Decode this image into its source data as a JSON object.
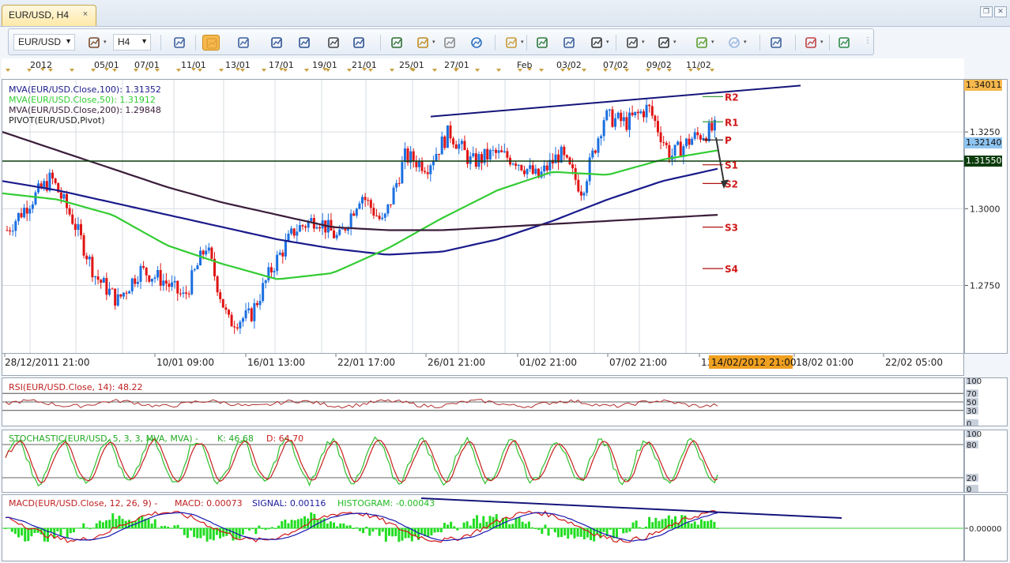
{
  "window": {
    "tab_title": "EUR/USD, H4",
    "close_glyph": "×",
    "restore_glyph": "❐",
    "close_window_glyph": "✕"
  },
  "toolbar": {
    "symbol": "EUR/USD",
    "timeframe": "H4",
    "icons": [
      "symbol-tools-icon",
      "chart-type-icon",
      "candles-icon",
      "ohlc-icon",
      "zoom-in-icon",
      "zoom-out-icon",
      "crosshair-icon",
      "zoom-area-icon",
      "indicator-icon",
      "edit-icon",
      "refresh-icon",
      "globe-icon",
      "ruler-icon",
      "image-icon",
      "template-icon",
      "trend-tools-icon",
      "lines-icon",
      "fib-fan-icon",
      "line-icon",
      "ellipse-icon",
      "text-icon",
      "eraser-icon",
      "hierarchy-icon"
    ],
    "colors": {
      "accent": "#f7b84d",
      "bg": "#e6edf6"
    }
  },
  "top_axis_labels": [
    "2012",
    "05/01",
    "07/01",
    "11/01",
    "13/01",
    "17/01",
    "19/01",
    "21/01",
    "25/01",
    "27/01",
    "Feb",
    "03/02",
    "07/02",
    "09/02",
    "11/02"
  ],
  "price_chart": {
    "legend": [
      {
        "text": "MVA(EUR/USD.Close,100): 1.31352",
        "color": "#1a1a8c"
      },
      {
        "text": "MVA(EUR/USD.Close,50): 1.31912",
        "color": "#33cc33"
      },
      {
        "text": "MVA(EUR/USD.Close,200): 1.29848",
        "color": "#3a1d3a"
      },
      {
        "text": "PIVOT(EUR/USD,Pivot)",
        "color": "#222222"
      }
    ],
    "pivot_labels": [
      "R2",
      "R1",
      "P",
      "S1",
      "S2",
      "S3",
      "S4"
    ],
    "y_ticks": [
      "1.3250",
      "1.3000",
      "1.2750"
    ],
    "price_tags": [
      {
        "text": "1.34011",
        "bg": "#f7b84d"
      },
      {
        "text": "1.32140",
        "bg": "#8fc4f0"
      },
      {
        "text": "1.31550",
        "bg": "#0b3b0b"
      }
    ],
    "bottom_axis_labels": [
      "28/12/2011 21:00",
      "10/01 09:00",
      "16/01 13:00",
      "22/01 17:00",
      "26/01 21:00",
      "01/02 21:00",
      "07/02 21:00",
      "13",
      "14/02/2012 21:00",
      "18/02 01:00",
      "22/02 05:00"
    ]
  },
  "rsi": {
    "label": "RSI(EUR/USD.Close, 14): 48.22",
    "axis": [
      "100",
      "70",
      "50",
      "30",
      "0"
    ]
  },
  "stochastic": {
    "label_prefix": "STOCHASTIC(EUR/USD, 5, 3, 3, MVA, MVA) -",
    "k_label": "K: 46.68",
    "d_label": "D: 64.70",
    "axis": [
      "100",
      "80",
      "20",
      "0"
    ]
  },
  "macd": {
    "label_prefix": "MACD(EUR/USD.Close, 12, 26, 9) -",
    "macd_label": "MACD: 0.00073",
    "signal_label": "SIGNAL: 0.00116",
    "histogram_label": "HISTOGRAM: -0.00043",
    "axis": [
      "0.00000"
    ]
  },
  "chart_data": {
    "type": "candlestick",
    "symbol": "EUR/USD",
    "timeframe": "H4",
    "x_start": "28/12/2011 21:00",
    "x_end_visible": "14/02/2012 21:00",
    "ylim": [
      1.253,
      1.342
    ],
    "y_ticks": [
      1.275,
      1.3,
      1.325
    ],
    "series": [
      {
        "name": "MVA(EUR/USD.Close,100)",
        "last": 1.31352,
        "color": "#1a1a8c",
        "values": [
          1.309,
          1.306,
          1.302,
          1.298,
          1.294,
          1.29,
          1.287,
          1.285,
          1.286,
          1.29,
          1.296,
          1.303,
          1.309,
          1.313
        ]
      },
      {
        "name": "MVA(EUR/USD.Close,50)",
        "last": 1.31912,
        "color": "#33cc33",
        "values": [
          1.305,
          1.303,
          1.298,
          1.288,
          1.282,
          1.277,
          1.279,
          1.287,
          1.297,
          1.306,
          1.312,
          1.311,
          1.316,
          1.319
        ]
      },
      {
        "name": "MVA(EUR/USD.Close,200)",
        "last": 1.29848,
        "color": "#3a1d3a",
        "values": [
          1.325,
          1.319,
          1.313,
          1.307,
          1.302,
          1.298,
          1.294,
          1.293,
          1.293,
          1.294,
          1.295,
          1.296,
          1.297,
          1.298
        ]
      }
    ],
    "close_approx": [
      1.293,
      1.302,
      1.31,
      1.296,
      1.278,
      1.27,
      1.28,
      1.277,
      1.271,
      1.288,
      1.263,
      1.265,
      1.281,
      1.293,
      1.297,
      1.29,
      1.305,
      1.295,
      1.317,
      1.314,
      1.325,
      1.315,
      1.318,
      1.316,
      1.31,
      1.318,
      1.306,
      1.33,
      1.328,
      1.333,
      1.317,
      1.323,
      1.326
    ],
    "pivot_levels": {
      "R2": 1.3365,
      "R1": 1.3283,
      "P": 1.3224,
      "S1": 1.3143,
      "S2": 1.3082,
      "S3": 1.294,
      "S4": 1.2805
    },
    "horizontal_line": 1.3155,
    "last_price": 1.3214,
    "upper_trendline_value": 1.3401,
    "rsi_last": 48.22,
    "stoch_k_last": 46.68,
    "stoch_d_last": 64.7,
    "macd_last": 0.00073,
    "signal_last": 0.00116,
    "histogram_last": -0.00043,
    "grid": true,
    "legend": "top-left"
  }
}
